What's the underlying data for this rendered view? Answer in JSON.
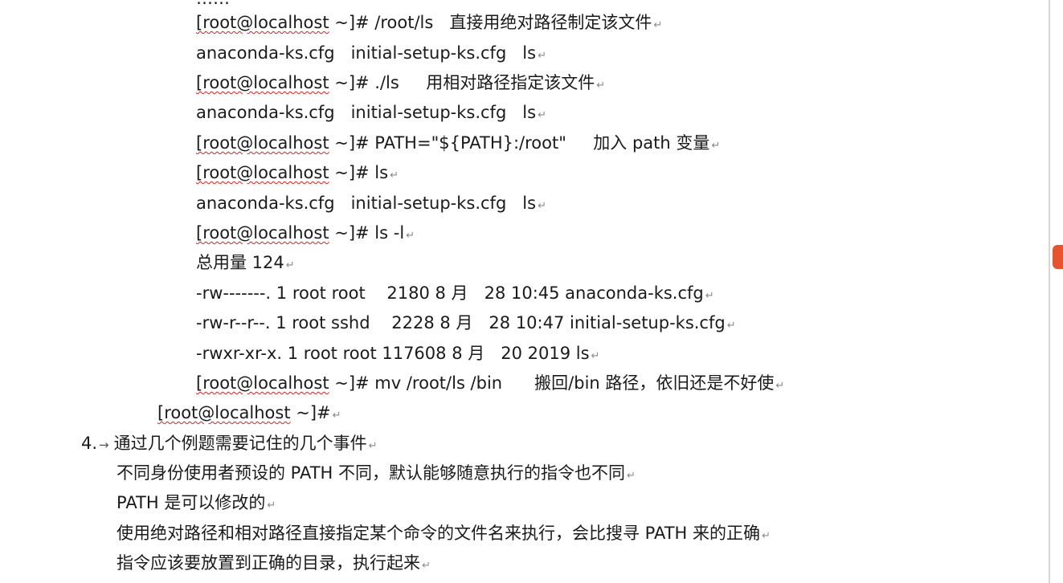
{
  "partial_top": "……",
  "code_lines": [
    {
      "prompt": "[root@localhost",
      "rest": " ~]# /root/ls   直接用绝对路径制定该文件"
    },
    {
      "text": "anaconda-ks.cfg   initial-setup-ks.cfg   ls"
    },
    {
      "prompt": "[root@localhost",
      "rest": " ~]# ./ls     用相对路径指定该文件"
    },
    {
      "text": "anaconda-ks.cfg   initial-setup-ks.cfg   ls"
    },
    {
      "prompt": "[root@localhost",
      "rest": " ~]# PATH=\"${PATH}:/root\"     加入 path 变量"
    },
    {
      "prompt": "[root@localhost",
      "rest": " ~]# ls"
    },
    {
      "text": "anaconda-ks.cfg   initial-setup-ks.cfg   ls"
    },
    {
      "prompt": "[root@localhost",
      "rest": " ~]# ls -l"
    },
    {
      "text": "总用量 124"
    },
    {
      "text": "-rw-------. 1 root root    2180 8 月   28 10:45 anaconda-ks.cfg"
    },
    {
      "text": "-rw-r--r--. 1 root sshd    2228 8 月   28 10:47 initial-setup-ks.cfg"
    },
    {
      "text": "-rwxr-xr-x. 1 root root 117608 8 月   20 2019 ls"
    },
    {
      "prompt": "[root@localhost",
      "rest": " ~]# mv /root/ls /bin      搬回/bin 路径，依旧还是不好使"
    }
  ],
  "final_prompt": {
    "prompt": "[root@localhost",
    "rest": " ~]#"
  },
  "section": {
    "number": "4.",
    "heading": "通过几个例题需要记住的几个事件",
    "items": [
      "不同身份使用者预设的 PATH 不同，默认能够随意执行的指令也不同",
      "PATH 是可以修改的",
      "使用绝对路径和相对路径直接指定某个命令的文件名来执行，会比搜寻 PATH 来的正确",
      "指令应该要放置到正确的目录，执行起来"
    ]
  },
  "paragraph_mark": "↵",
  "arrow_mark": "→",
  "colors": {
    "spell_underline": "#dd2222",
    "side_badge": "#e8542d"
  }
}
